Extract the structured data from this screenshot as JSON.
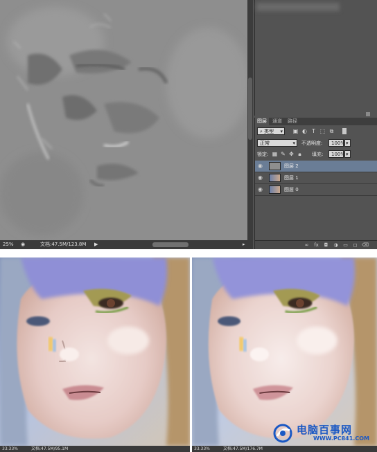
{
  "canvas": {
    "zoom": "25%",
    "doc_info": "文档:47.5M/123.8M"
  },
  "layers_panel": {
    "tabs": [
      "图层",
      "通道",
      "路径"
    ],
    "active_tab": "图层",
    "filter_label": "类型",
    "blend_mode": "正常",
    "opacity_label": "不透明度:",
    "opacity_value": "100%",
    "lock_label": "锁定:",
    "fill_label": "填充:",
    "fill_value": "100%",
    "layers": [
      {
        "name": "图层 2",
        "selected": true
      },
      {
        "name": "图层 1",
        "selected": false
      },
      {
        "name": "图层 0",
        "selected": false
      }
    ]
  },
  "photos": [
    {
      "zoom": "33.33%",
      "doc_info": "文档:47.5M/95.1M"
    },
    {
      "zoom": "33.33%",
      "doc_info": "文档:47.5M/176.7M"
    }
  ],
  "watermark": {
    "title": "电脑百事网",
    "url": "WWW.PC841.COM"
  },
  "icons": {
    "eye": "eye-icon",
    "lock": "lock-icon",
    "brush": "brush-icon",
    "move": "move-icon",
    "link": "link-icon",
    "fx": "fx-icon",
    "mask": "mask-icon",
    "adjust": "adjustment-icon",
    "folder": "folder-icon",
    "new": "new-layer-icon",
    "trash": "trash-icon"
  },
  "colors": {
    "panel_bg": "#535353",
    "selected_layer": "#6a7d96",
    "canvas_gray": "#8f8f8f",
    "watermark_blue": "#1a58c4"
  }
}
